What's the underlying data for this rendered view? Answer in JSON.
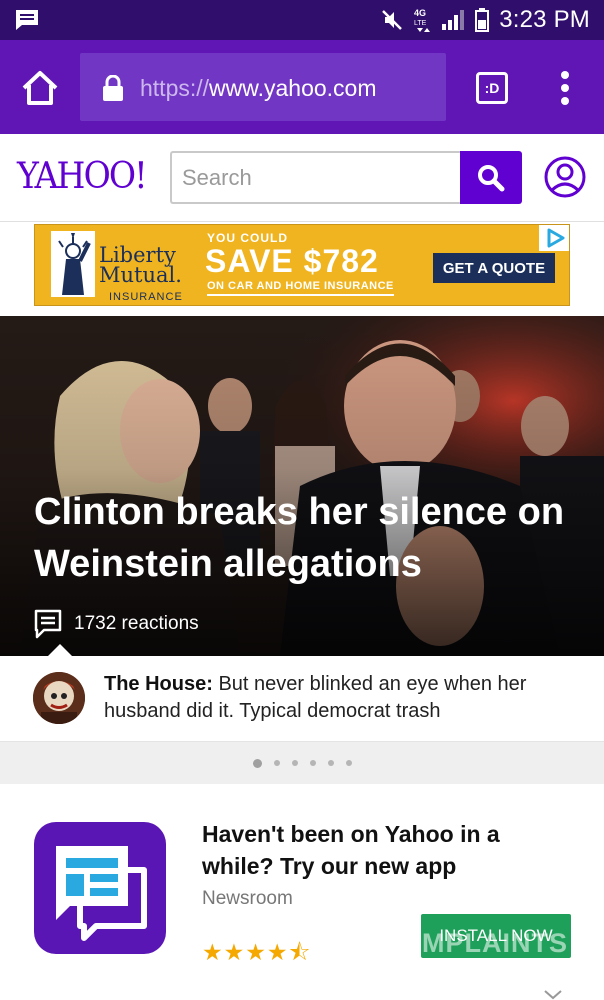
{
  "status_bar": {
    "time": "3:23 PM",
    "network": "4G LTE"
  },
  "browser": {
    "url_scheme": "https://",
    "url_host": "www.yahoo.com",
    "tab_label": ":D"
  },
  "header": {
    "logo": "YAHOO!",
    "search_placeholder": "Search"
  },
  "ad": {
    "brand_line1": "Liberty",
    "brand_line2": "Mutual.",
    "brand_sub": "INSURANCE",
    "kicker": "YOU COULD",
    "headline": "SAVE $782",
    "subline": "ON CAR AND HOME INSURANCE",
    "cta": "GET A QUOTE"
  },
  "hero": {
    "title": "Clinton breaks her silence on Weinstein allegations",
    "reactions": "1732 reactions"
  },
  "comment": {
    "author": "The House:",
    "text": "But never blinked an eye when her husband did it. Typical democrat trash"
  },
  "carousel": {
    "total": 6,
    "active": 1
  },
  "promo": {
    "headline": "Haven't been on Yahoo in a while? Try our new app",
    "app_name": "Newsroom",
    "rating_stars": 4.5,
    "stars_text": "★★★★⯪",
    "install_label": "INSTALL NOW",
    "watermark": "MPLAINTS"
  },
  "colors": {
    "status_bar": "#2f0f6b",
    "toolbar": "#5f16b4",
    "yahoo_purple": "#6001d2",
    "ad_yellow": "#efb420",
    "install_green": "#1ea05a"
  }
}
